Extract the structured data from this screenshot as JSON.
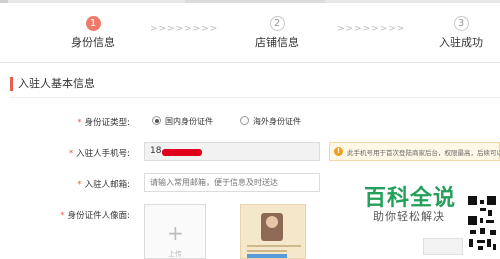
{
  "steps": [
    {
      "number": "1",
      "label": "身份信息",
      "state": "active"
    },
    {
      "number": "2",
      "label": "店铺信息",
      "state": "inactive"
    },
    {
      "number": "3",
      "label": "入驻成功",
      "state": "inactive"
    }
  ],
  "step_separator": ">>>>>>>>",
  "section": {
    "title": "入驻人基本信息"
  },
  "form": {
    "id_type": {
      "label": "身份证类型:",
      "options": [
        {
          "label": "国内身份证件",
          "selected": true
        },
        {
          "label": "海外身份证件",
          "selected": false
        }
      ]
    },
    "phone": {
      "label": "入驻人手机号:",
      "value_prefix": "18"
    },
    "warning": {
      "text": "此手机号用于首次登陆商家后台，权限最高，后续可以"
    },
    "email": {
      "label": "入驻人邮箱:",
      "placeholder": "请输入常用邮箱，便于信息及时送达"
    },
    "id_photo": {
      "label": "身份证件人像面:",
      "upload_label": "上传"
    }
  },
  "watermark": {
    "title": "百科全说",
    "subtitle": "助你轻松解决"
  },
  "colors": {
    "accent": "#e8604c",
    "step_active": "#f07a6a",
    "watermark": "#24a05a",
    "redaction": "#e0001b"
  },
  "icons": {
    "warning": "warning-icon",
    "upload": "plus-icon"
  }
}
